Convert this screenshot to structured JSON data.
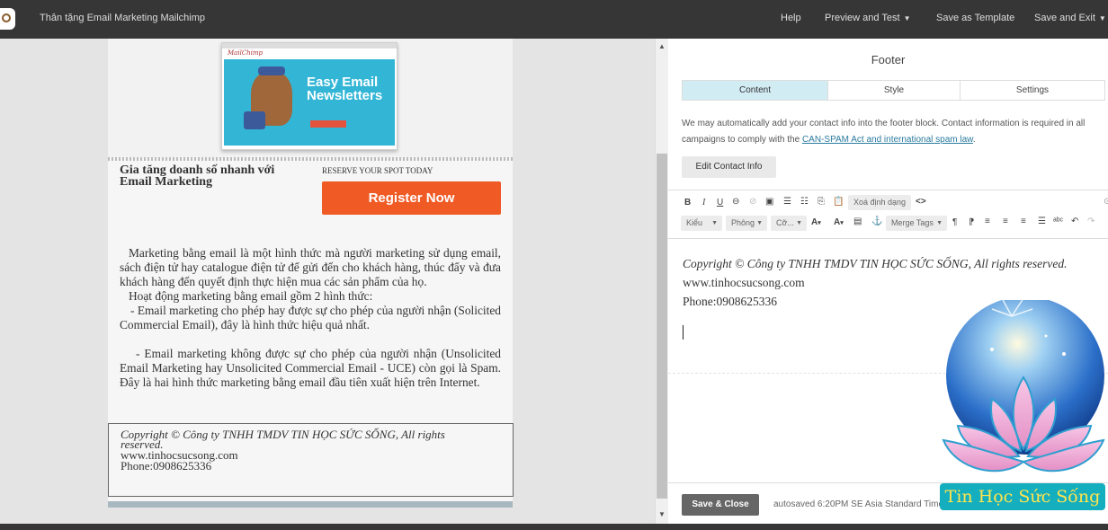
{
  "topbar": {
    "title": "Thân tặng Email Marketing Mailchimp",
    "help": "Help",
    "preview_test": "Preview and Test",
    "save_template": "Save as Template",
    "save_exit": "Save and Exit"
  },
  "email": {
    "hero": {
      "brand": "MailChimp",
      "headline": "Easy Email Newsletters"
    },
    "cta": {
      "title": "Gia tăng doanh số nhanh với Email Marketing",
      "reserve": "RESERVE YOUR SPOT TODAY",
      "button": "Register Now"
    },
    "body": [
      "Marketing bằng email là một hình thức mà người marketing sử dụng email, sách điện tử hay catalogue điện tử để gửi đến cho khách hàng, thúc đẩy và đưa khách hàng đến quyết định thực hiện mua các sản phẩm của họ.",
      "Hoạt động marketing bằng email gồm 2 hình thức:",
      "- Email marketing cho phép hay được sự cho phép của người nhận (Solicited Commercial Email), đây là hình thức hiệu quả nhất.",
      "- Email marketing không được sự cho phép của người nhận (Unsolicited Email Marketing hay Unsolicited Commercial Email - UCE) còn gọi là Spam. Đây là hai hình thức marketing bằng email đầu tiên xuất hiện trên Internet."
    ],
    "footer": {
      "copyright_1": "Copyright © Công ty TNHH TMDV TIN HỌC SỨC SỐNG, All rights",
      "copyright_2": "reserved.",
      "website": "www.tinhocsucsong.com",
      "phone": "Phone:0908625336"
    }
  },
  "panel": {
    "title": "Footer",
    "tabs": [
      "Content",
      "Style",
      "Settings"
    ],
    "notice": "We may automatically add your contact info into the footer block. Contact information is required in all campaigns to comply with the",
    "notice_link": "CAN-SPAM Act and international spam law",
    "edit_contact": "Edit Contact Info",
    "toolbar": {
      "clear_format": "Xoá định dạng",
      "styles": "Kiểu",
      "font": "Phông",
      "size": "Cỡ...",
      "merge_tags": "Merge Tags"
    },
    "editor": {
      "copyright": "Copyright © Công ty TNHH TMDV TIN HỌC SỨC SỐNG, All rights reserved.",
      "website": "www.tinhocsucsong.com",
      "phone": "Phone:0908625336"
    },
    "save_close": "Save & Close",
    "autosaved": "autosaved 6:20PM SE Asia Standard Time"
  },
  "watermark": {
    "caption": "Tin Học Sức Sống"
  }
}
